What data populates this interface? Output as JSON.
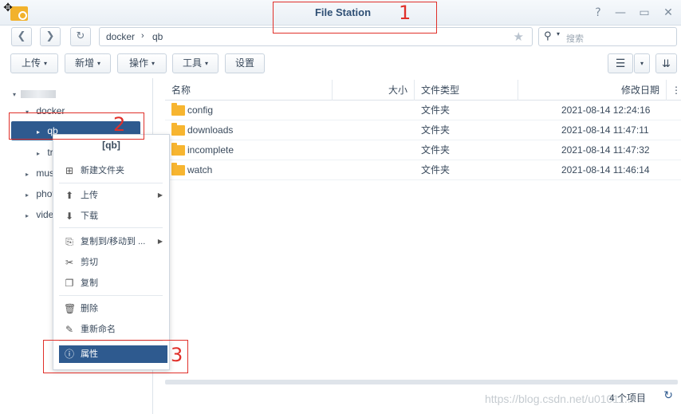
{
  "window": {
    "title": "File Station",
    "help_glyph": "?",
    "minimize_glyph": "—",
    "maximize_glyph": "▭",
    "close_glyph": "✕",
    "move_glyph": "✥"
  },
  "nav": {
    "back_glyph": "❮",
    "forward_glyph": "❯",
    "refresh_glyph": "↻",
    "path": [
      "docker",
      "qb"
    ],
    "path_separator": "›",
    "favorite_glyph": "★"
  },
  "search": {
    "icon": "search-icon",
    "icon_glyph": "⚲",
    "caret": "▾",
    "placeholder": "搜索"
  },
  "toolbar": {
    "upload": "上传",
    "create": "新增",
    "action": "操作",
    "tools": "工具",
    "settings": "设置",
    "caret": "▾",
    "view_glyph": "☰",
    "sort_glyph": "⇊"
  },
  "tree": {
    "nodes": [
      {
        "label": "",
        "arrow": "▾",
        "blurred": true
      },
      {
        "label": "docker",
        "arrow": "▾"
      },
      {
        "label": "qb",
        "arrow": "▸"
      },
      {
        "label": "tr",
        "arrow": "▸"
      },
      {
        "label": "mus",
        "arrow": "▸"
      },
      {
        "label": "phot",
        "arrow": "▸"
      },
      {
        "label": "vide",
        "arrow": "▸"
      }
    ]
  },
  "list": {
    "columns": {
      "name": "名称",
      "size": "大小",
      "type": "文件类型",
      "modified": "修改日期",
      "more": "⋮"
    },
    "rows": [
      {
        "name": "config",
        "size": "",
        "type": "文件夹",
        "modified": "2021-08-14 12:24:16"
      },
      {
        "name": "downloads",
        "size": "",
        "type": "文件夹",
        "modified": "2021-08-14 11:47:11"
      },
      {
        "name": "incomplete",
        "size": "",
        "type": "文件夹",
        "modified": "2021-08-14 11:47:32"
      },
      {
        "name": "watch",
        "size": "",
        "type": "文件夹",
        "modified": "2021-08-14 11:46:14"
      }
    ]
  },
  "status": {
    "count": "4 个项目",
    "refresh_glyph": "↻"
  },
  "context_menu": {
    "title": "[qb]",
    "items": [
      {
        "label": "新建文件夹",
        "icon": "new-folder-icon",
        "glyph": "⊞",
        "submenu": false
      },
      {
        "label": "上传",
        "icon": "upload-icon",
        "glyph": "⬆",
        "submenu": true
      },
      {
        "label": "下载",
        "icon": "download-icon",
        "glyph": "⬇",
        "submenu": false
      },
      {
        "label": "复制到/移动到 ...",
        "icon": "copy-move-icon",
        "glyph": "⎘",
        "submenu": true
      },
      {
        "label": "剪切",
        "icon": "scissors-icon",
        "glyph": "✂",
        "submenu": false
      },
      {
        "label": "复制",
        "icon": "copy-icon",
        "glyph": "❐",
        "submenu": false
      },
      {
        "label": "删除",
        "icon": "trash-icon",
        "glyph": "🗑",
        "submenu": false
      },
      {
        "label": "重新命名",
        "icon": "rename-icon",
        "glyph": "✎",
        "submenu": false
      },
      {
        "label": "属性",
        "icon": "info-icon",
        "glyph": "ⓘ",
        "submenu": false
      }
    ],
    "submenu_glyph": "▶"
  },
  "annotations": [
    "1",
    "2",
    "3"
  ],
  "watermark": "https://blog.csdn.net/u01011...",
  "colors": {
    "accent": "#2e5a8f",
    "folder": "#f7b530",
    "annotation": "#e0302a",
    "title": "#2f4f74"
  }
}
